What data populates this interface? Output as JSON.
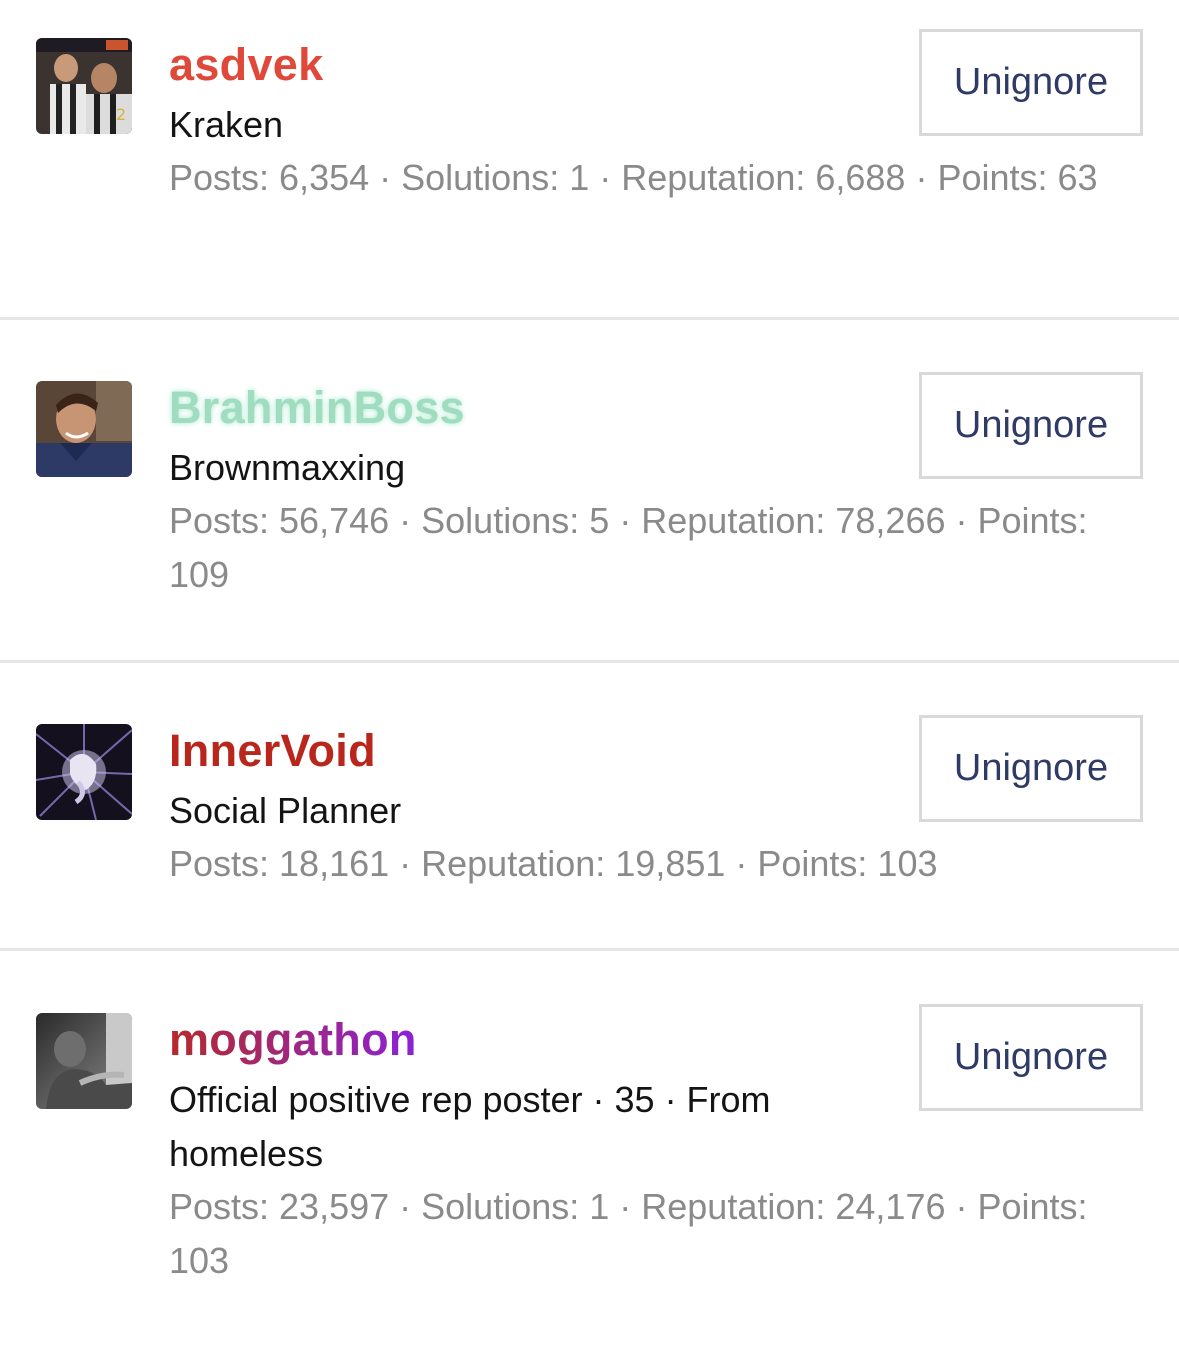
{
  "users": [
    {
      "username": "asdvek",
      "username_color": "#e0493a",
      "title": "Kraken",
      "stats": "Posts: 6,354 · Solutions: 1 · Reputation: 6,688 · Points: 63",
      "button_label": "Unignore"
    },
    {
      "username": "BrahminBoss",
      "username_color": "#9fdcc0",
      "title": "Brownmaxxing",
      "stats": "Posts: 56,746 · Solutions: 5 · Reputation: 78,266 · Points: 109",
      "button_label": "Unignore"
    },
    {
      "username": "InnerVoid",
      "username_color": "#b8261c",
      "title": "Social Planner",
      "stats": "Posts: 18,161 · Reputation: 19,851 · Points: 103",
      "button_label": "Unignore"
    },
    {
      "username": "moggathon",
      "username_color": "#a020c8",
      "title": "Official positive rep poster · 35 · From homeless",
      "stats": "Posts: 23,597 · Solutions: 1 · Reputation: 24,176 · Points: 103",
      "button_label": "Unignore"
    }
  ],
  "colors": {
    "button_text": "#2f3a66",
    "stats_text": "#8a8a8a",
    "divider": "#e6e6e6"
  },
  "icons": [
    "avatar-asdvek",
    "avatar-brahminboss",
    "avatar-innervoid",
    "avatar-moggathon"
  ]
}
